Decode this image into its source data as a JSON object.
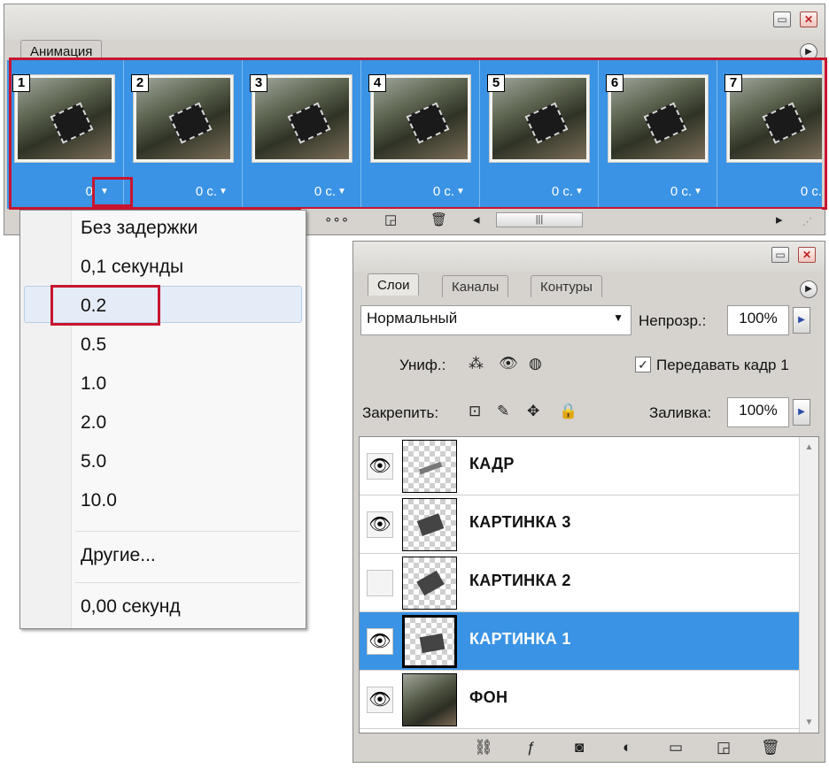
{
  "animation": {
    "tab_label": "Анимация",
    "frames": [
      {
        "num": "1",
        "delay": "0 с."
      },
      {
        "num": "2",
        "delay": "0 с."
      },
      {
        "num": "3",
        "delay": "0 с."
      },
      {
        "num": "4",
        "delay": "0 с."
      },
      {
        "num": "5",
        "delay": "0 с."
      },
      {
        "num": "6",
        "delay": "0 с."
      },
      {
        "num": "7",
        "delay": "0 с."
      }
    ],
    "first_frame_delay": "0"
  },
  "delay_menu": {
    "items": [
      "Без задержки",
      "0,1 секунды",
      "0.2",
      "0.5",
      "1.0",
      "2.0",
      "5.0",
      "10.0"
    ],
    "other": "Другие...",
    "current": "0,00 секунд",
    "highlighted": "0.2"
  },
  "layers": {
    "tabs": [
      "Слои",
      "Каналы",
      "Контуры"
    ],
    "blend_mode": "Нормальный",
    "opacity_label": "Непрозр.:",
    "opacity_value": "100%",
    "unify_label": "Униф.:",
    "propagate_label": "Передавать кадр 1",
    "lock_label": "Закрепить:",
    "fill_label": "Заливка:",
    "fill_value": "100%",
    "list": [
      {
        "name": "КАДР",
        "visible": true,
        "selected": false
      },
      {
        "name": "КАРТИНКА 3",
        "visible": true,
        "selected": false
      },
      {
        "name": "КАРТИНКА 2",
        "visible": false,
        "selected": false
      },
      {
        "name": "КАРТИНКА 1",
        "visible": true,
        "selected": true
      },
      {
        "name": "ФОН",
        "visible": true,
        "selected": false
      }
    ]
  },
  "colors": {
    "selection_blue": "#3a93e4",
    "highlight_red": "#c8152f"
  }
}
